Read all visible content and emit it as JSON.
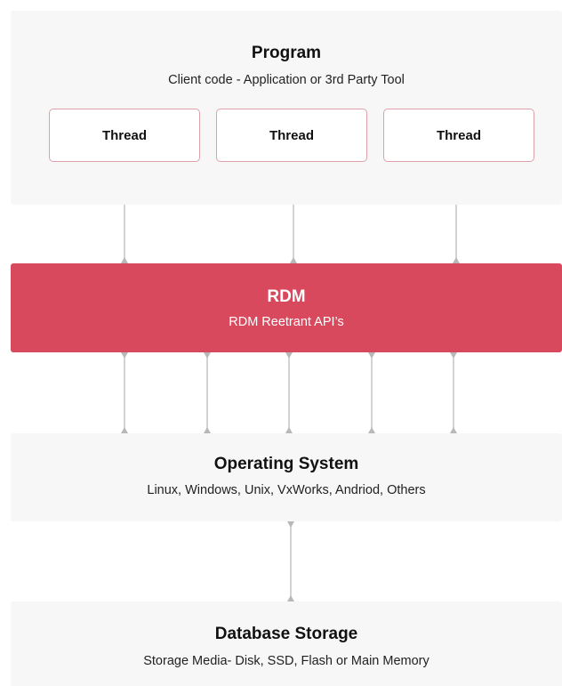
{
  "program": {
    "title": "Program",
    "subtitle": "Client code - Application or 3rd Party Tool",
    "threads": [
      "Thread",
      "Thread",
      "Thread"
    ]
  },
  "rdm": {
    "title": "RDM",
    "subtitle": "RDM Reetrant API’s"
  },
  "os": {
    "title": "Operating System",
    "subtitle": "Linux, Windows, Unix, VxWorks, Andriod, Others"
  },
  "storage": {
    "title": "Database Storage",
    "subtitle": "Storage Media- Disk, SSD, Flash or Main Memory"
  },
  "colors": {
    "rdm_fill": "#d9495d",
    "layer_fill": "#f7f7f7",
    "thread_border": "#e0a0aa",
    "connector": "#c4c4c4"
  }
}
